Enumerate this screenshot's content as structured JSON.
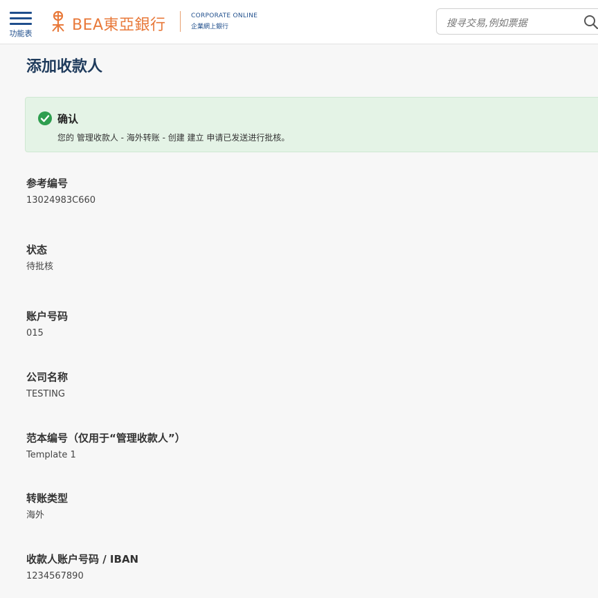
{
  "header": {
    "menu_label": "功能表",
    "logo": {
      "brand": "BEA東亞銀行",
      "sub_title_en": "CORPORATE ONLINE",
      "sub_title_zh": "企業網上銀行"
    },
    "search": {
      "placeholder": "搜寻交易,例如票据",
      "icon": "search-icon"
    }
  },
  "main": {
    "title": "添加收款人",
    "alert": {
      "icon": "check-circle-icon",
      "title": "确认",
      "message": "您的 管理收款人 - 海外转账 - 创建 建立 申请已发送进行批核。",
      "color": "#2e9e4f"
    },
    "fields": [
      {
        "label": "参考编号",
        "value": "13024983C660"
      },
      {
        "label": "状态",
        "value": "待批核"
      },
      {
        "label": "账户号码",
        "value": "015"
      },
      {
        "label": "公司名称",
        "value": "TESTING"
      },
      {
        "label": "范本编号（仅用于“管理收款人”）",
        "value": "Template 1"
      },
      {
        "label": "转账类型",
        "value": "海外"
      },
      {
        "label": "收款人账户号码 / IBAN",
        "value": "1234567890"
      }
    ]
  },
  "colors": {
    "brand_orange": "#e8793a",
    "brand_blue": "#1f4e8c",
    "title_navy": "#1f3b5c",
    "alert_bg": "#e4f3e6"
  }
}
